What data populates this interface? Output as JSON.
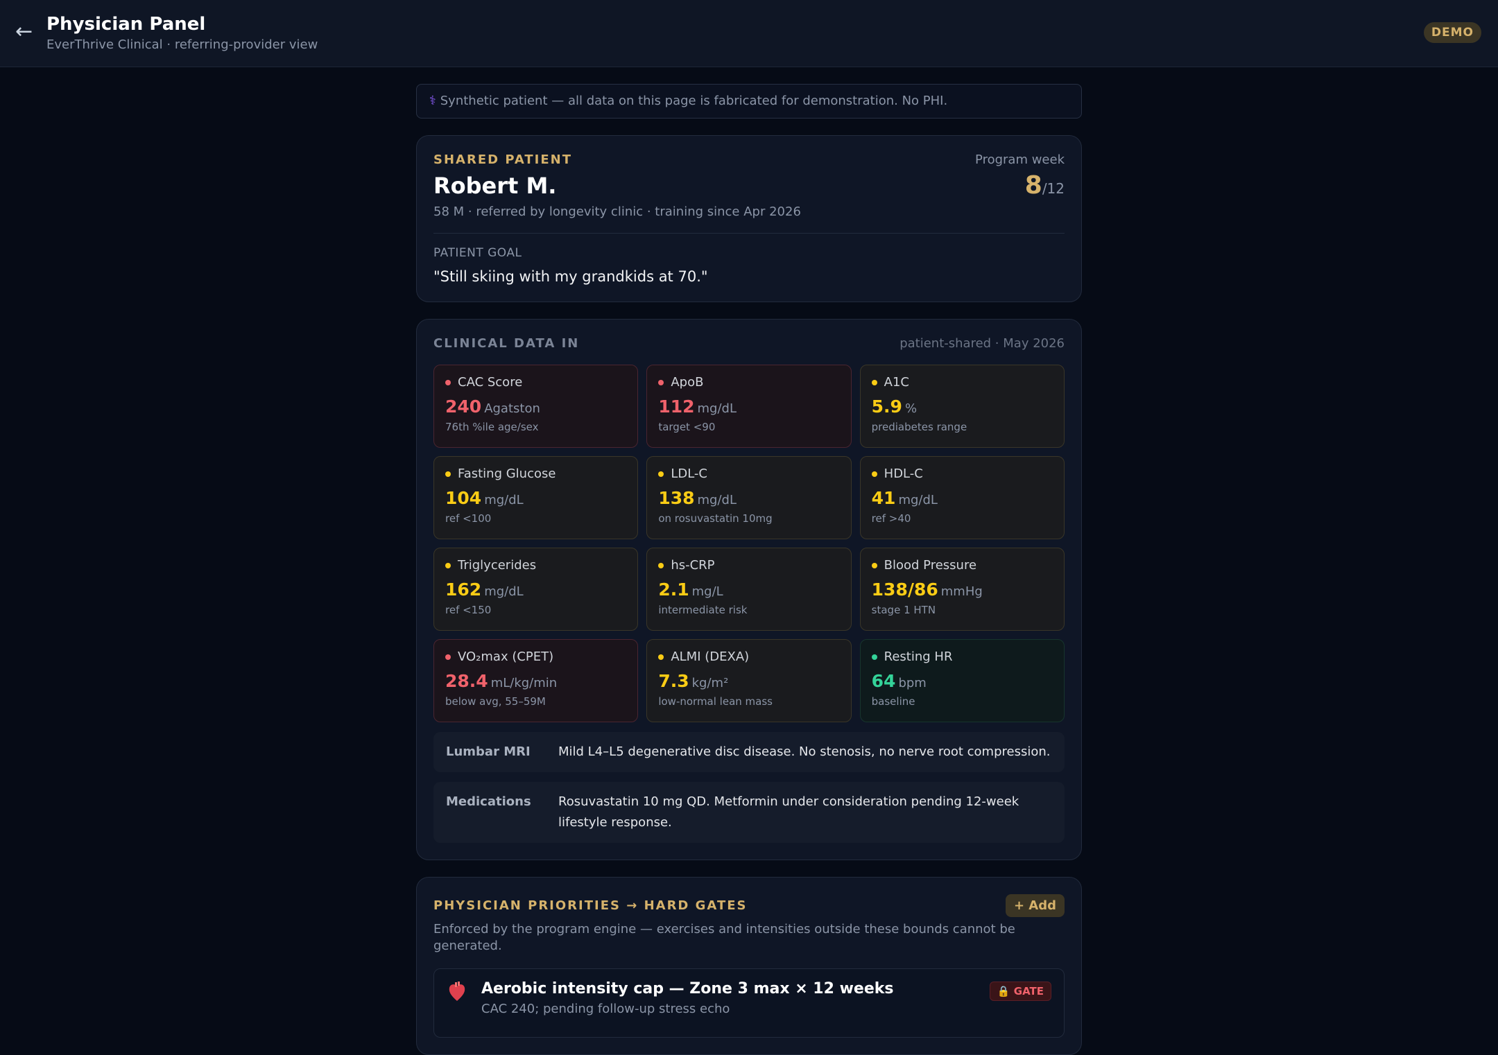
{
  "header": {
    "back_glyph": "←",
    "title": "Physician Panel",
    "subtitle": "EverThrive Clinical · referring-provider view",
    "badge": "DEMO"
  },
  "notice": {
    "icon": "caduceus-icon",
    "glyph": "⚕",
    "text": "Synthetic patient — all data on this page is fabricated for demonstration. No PHI."
  },
  "patient": {
    "eyebrow": "SHARED PATIENT",
    "name": "Robert M.",
    "meta": "58 M · referred by longevity clinic · training since Apr 2026",
    "week_label": "Program week",
    "week_current": "8",
    "week_total": "/12",
    "goal_label": "PATIENT GOAL",
    "goal": "\"Still skiing with my grandkids at 70.\""
  },
  "clinical": {
    "title": "CLINICAL DATA IN",
    "source": "patient-shared · May 2026",
    "tiles": [
      {
        "name": "CAC Score",
        "value": "240",
        "unit": "Agatston",
        "note": "76th %ile age/sex",
        "status": "red"
      },
      {
        "name": "ApoB",
        "value": "112",
        "unit": "mg/dL",
        "note": "target <90",
        "status": "red"
      },
      {
        "name": "A1C",
        "value": "5.9",
        "unit": "%",
        "note": "prediabetes range",
        "status": "yellow"
      },
      {
        "name": "Fasting Glucose",
        "value": "104",
        "unit": "mg/dL",
        "note": "ref <100",
        "status": "yellow"
      },
      {
        "name": "LDL-C",
        "value": "138",
        "unit": "mg/dL",
        "note": "on rosuvastatin 10mg",
        "status": "yellow"
      },
      {
        "name": "HDL-C",
        "value": "41",
        "unit": "mg/dL",
        "note": "ref >40",
        "status": "yellow"
      },
      {
        "name": "Triglycerides",
        "value": "162",
        "unit": "mg/dL",
        "note": "ref <150",
        "status": "yellow"
      },
      {
        "name": "hs-CRP",
        "value": "2.1",
        "unit": "mg/L",
        "note": "intermediate risk",
        "status": "yellow"
      },
      {
        "name": "Blood Pressure",
        "value": "138/86",
        "unit": "mmHg",
        "note": "stage 1 HTN",
        "status": "yellow"
      },
      {
        "name": "VO₂max (CPET)",
        "value": "28.4",
        "unit": "mL/kg/min",
        "note": "below avg, 55–59M",
        "status": "red"
      },
      {
        "name": "ALMI (DEXA)",
        "value": "7.3",
        "unit": "kg/m²",
        "note": "low-normal lean mass",
        "status": "yellow"
      },
      {
        "name": "Resting HR",
        "value": "64",
        "unit": "bpm",
        "note": "baseline",
        "status": "green"
      }
    ],
    "mri_label": "Lumbar MRI",
    "mri_text": "Mild L4–L5 degenerative disc disease. No stenosis, no nerve root compression.",
    "meds_label": "Medications",
    "meds_text": "Rosuvastatin 10 mg QD. Metformin under consideration pending 12-week lifestyle response."
  },
  "priorities": {
    "title": "PHYSICIAN PRIORITIES → HARD GATES",
    "add_label": "+ Add",
    "description": "Enforced by the program engine — exercises and intensities outside these bounds cannot be generated.",
    "gates": [
      {
        "icon": "heart-icon",
        "title": "Aerobic intensity cap — Zone 3 max × 12 weeks",
        "subtitle": "CAC 240; pending follow-up stress echo",
        "badge": "🔒 GATE"
      }
    ]
  },
  "colors": {
    "background": "#060b16",
    "accent_gold": "#d6b26b",
    "status_red": "#f0626b",
    "status_yellow": "#facc15",
    "status_green": "#34d399"
  }
}
